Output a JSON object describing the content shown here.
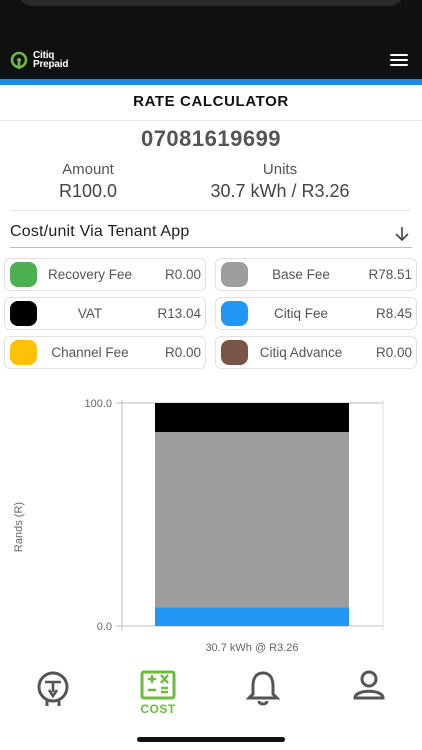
{
  "header": {
    "logo_line1": "Citiq",
    "logo_line2": "Prepaid",
    "brand_color": "#6cbb3c",
    "accent_color": "#1e88e5"
  },
  "page": {
    "title": "RATE CALCULATOR",
    "meter_number": "07081619699"
  },
  "summary": {
    "amount_label": "Amount",
    "amount_value": "R100.0",
    "units_label": "Units",
    "units_value": "30.7 kWh / R3.26"
  },
  "cost_select": {
    "selected": "Cost/unit Via Tenant App"
  },
  "fees": [
    {
      "name": "Recovery Fee",
      "value": "R0.00",
      "color": "#4caf50"
    },
    {
      "name": "Base Fee",
      "value": "R78.51",
      "color": "#9e9e9e"
    },
    {
      "name": "VAT",
      "value": "R13.04",
      "color": "#000000"
    },
    {
      "name": "Citiq Fee",
      "value": "R8.45",
      "color": "#2196f3"
    },
    {
      "name": "Channel Fee",
      "value": "R0.00",
      "color": "#ffc107"
    },
    {
      "name": "Citiq Advance",
      "value": "R0.00",
      "color": "#795548"
    }
  ],
  "chart_data": {
    "type": "bar",
    "stacked": true,
    "categories": [
      "30.7 kWh @ R3.26"
    ],
    "series": [
      {
        "name": "Citiq Fee",
        "values": [
          8.45
        ],
        "color": "#2196f3"
      },
      {
        "name": "Base Fee",
        "values": [
          78.51
        ],
        "color": "#9e9e9e"
      },
      {
        "name": "VAT",
        "values": [
          13.04
        ],
        "color": "#000000"
      }
    ],
    "ylabel": "Rands (R)",
    "ylim": [
      0,
      100
    ],
    "ytick_labels": [
      "0.0",
      "100.0"
    ],
    "yticks": [
      0,
      100
    ]
  },
  "nav": {
    "items": [
      {
        "icon": "meter-icon",
        "label": ""
      },
      {
        "icon": "calculator-icon",
        "label": "COST"
      },
      {
        "icon": "bell-icon",
        "label": ""
      },
      {
        "icon": "person-icon",
        "label": ""
      }
    ]
  }
}
